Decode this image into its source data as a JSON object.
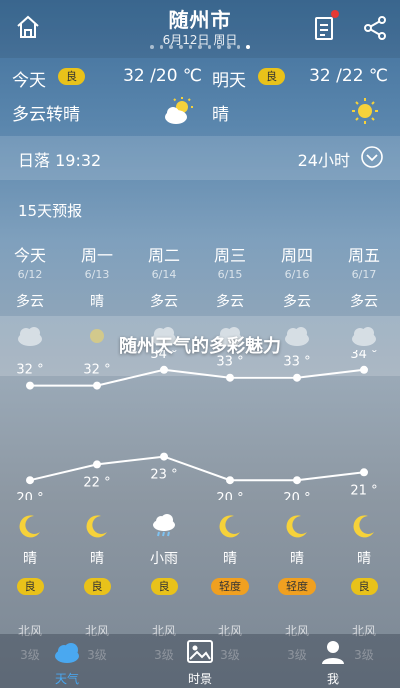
{
  "header": {
    "city": "随州市",
    "date": "6月12日 周日"
  },
  "today": {
    "label": "今天",
    "aqi": "良",
    "temp": "32 /20 ℃",
    "condition": "多云转晴",
    "icon": "partly-cloudy-icon"
  },
  "tomorrow": {
    "label": "明天",
    "aqi": "良",
    "temp": "32 /22 ℃",
    "condition": "晴",
    "icon": "sun-icon"
  },
  "sunset_bar": {
    "sunset": "日落 19:32",
    "mode": "24小时"
  },
  "forecast": {
    "title": "15天预报",
    "days": [
      {
        "name": "今天",
        "date": "6/12",
        "day_cond": "多云",
        "high": "32 °",
        "low": "20 °",
        "night_cond": "晴",
        "aqi": "良",
        "wind": "北风",
        "wind_level": "3级"
      },
      {
        "name": "周一",
        "date": "6/13",
        "day_cond": "晴",
        "high": "32 °",
        "low": "22 °",
        "night_cond": "晴",
        "aqi": "良",
        "wind": "北风",
        "wind_level": "3级"
      },
      {
        "name": "周二",
        "date": "6/14",
        "day_cond": "多云",
        "high": "34 °",
        "low": "23 °",
        "night_cond": "小雨",
        "aqi": "良",
        "wind": "北风",
        "wind_level": "3级"
      },
      {
        "name": "周三",
        "date": "6/15",
        "day_cond": "多云",
        "high": "33 °",
        "low": "20 °",
        "night_cond": "晴",
        "aqi": "轻度",
        "wind": "北风",
        "wind_level": "3级"
      },
      {
        "name": "周四",
        "date": "6/16",
        "day_cond": "多云",
        "high": "33 °",
        "low": "20 °",
        "night_cond": "晴",
        "aqi": "轻度",
        "wind": "北风",
        "wind_level": "3级"
      },
      {
        "name": "周五",
        "date": "6/17",
        "day_cond": "多云",
        "high": "34 °",
        "low": "21 °",
        "night_cond": "晴",
        "aqi": "良",
        "wind": "北风",
        "wind_level": "3级"
      }
    ]
  },
  "chart_data": {
    "type": "line",
    "categories": [
      "今天",
      "周一",
      "周二",
      "周三",
      "周四",
      "周五"
    ],
    "series": [
      {
        "values": [
          32,
          32,
          34,
          33,
          33,
          34
        ]
      },
      {
        "values": [
          20,
          22,
          23,
          20,
          20,
          21
        ]
      }
    ],
    "ylim": [
      18,
      36
    ]
  },
  "banner": {
    "text": "随州天气的多彩魅力"
  },
  "tabs": [
    {
      "label": "天气",
      "icon": "cloud-icon",
      "active": true
    },
    {
      "label": "时景",
      "icon": "photo-icon",
      "active": false
    },
    {
      "label": "我",
      "icon": "user-icon",
      "active": false
    }
  ],
  "colors": {
    "aqi_good": "#e9c21a",
    "aqi_light": "#f0a020",
    "active_tab": "#4aa8f0"
  }
}
